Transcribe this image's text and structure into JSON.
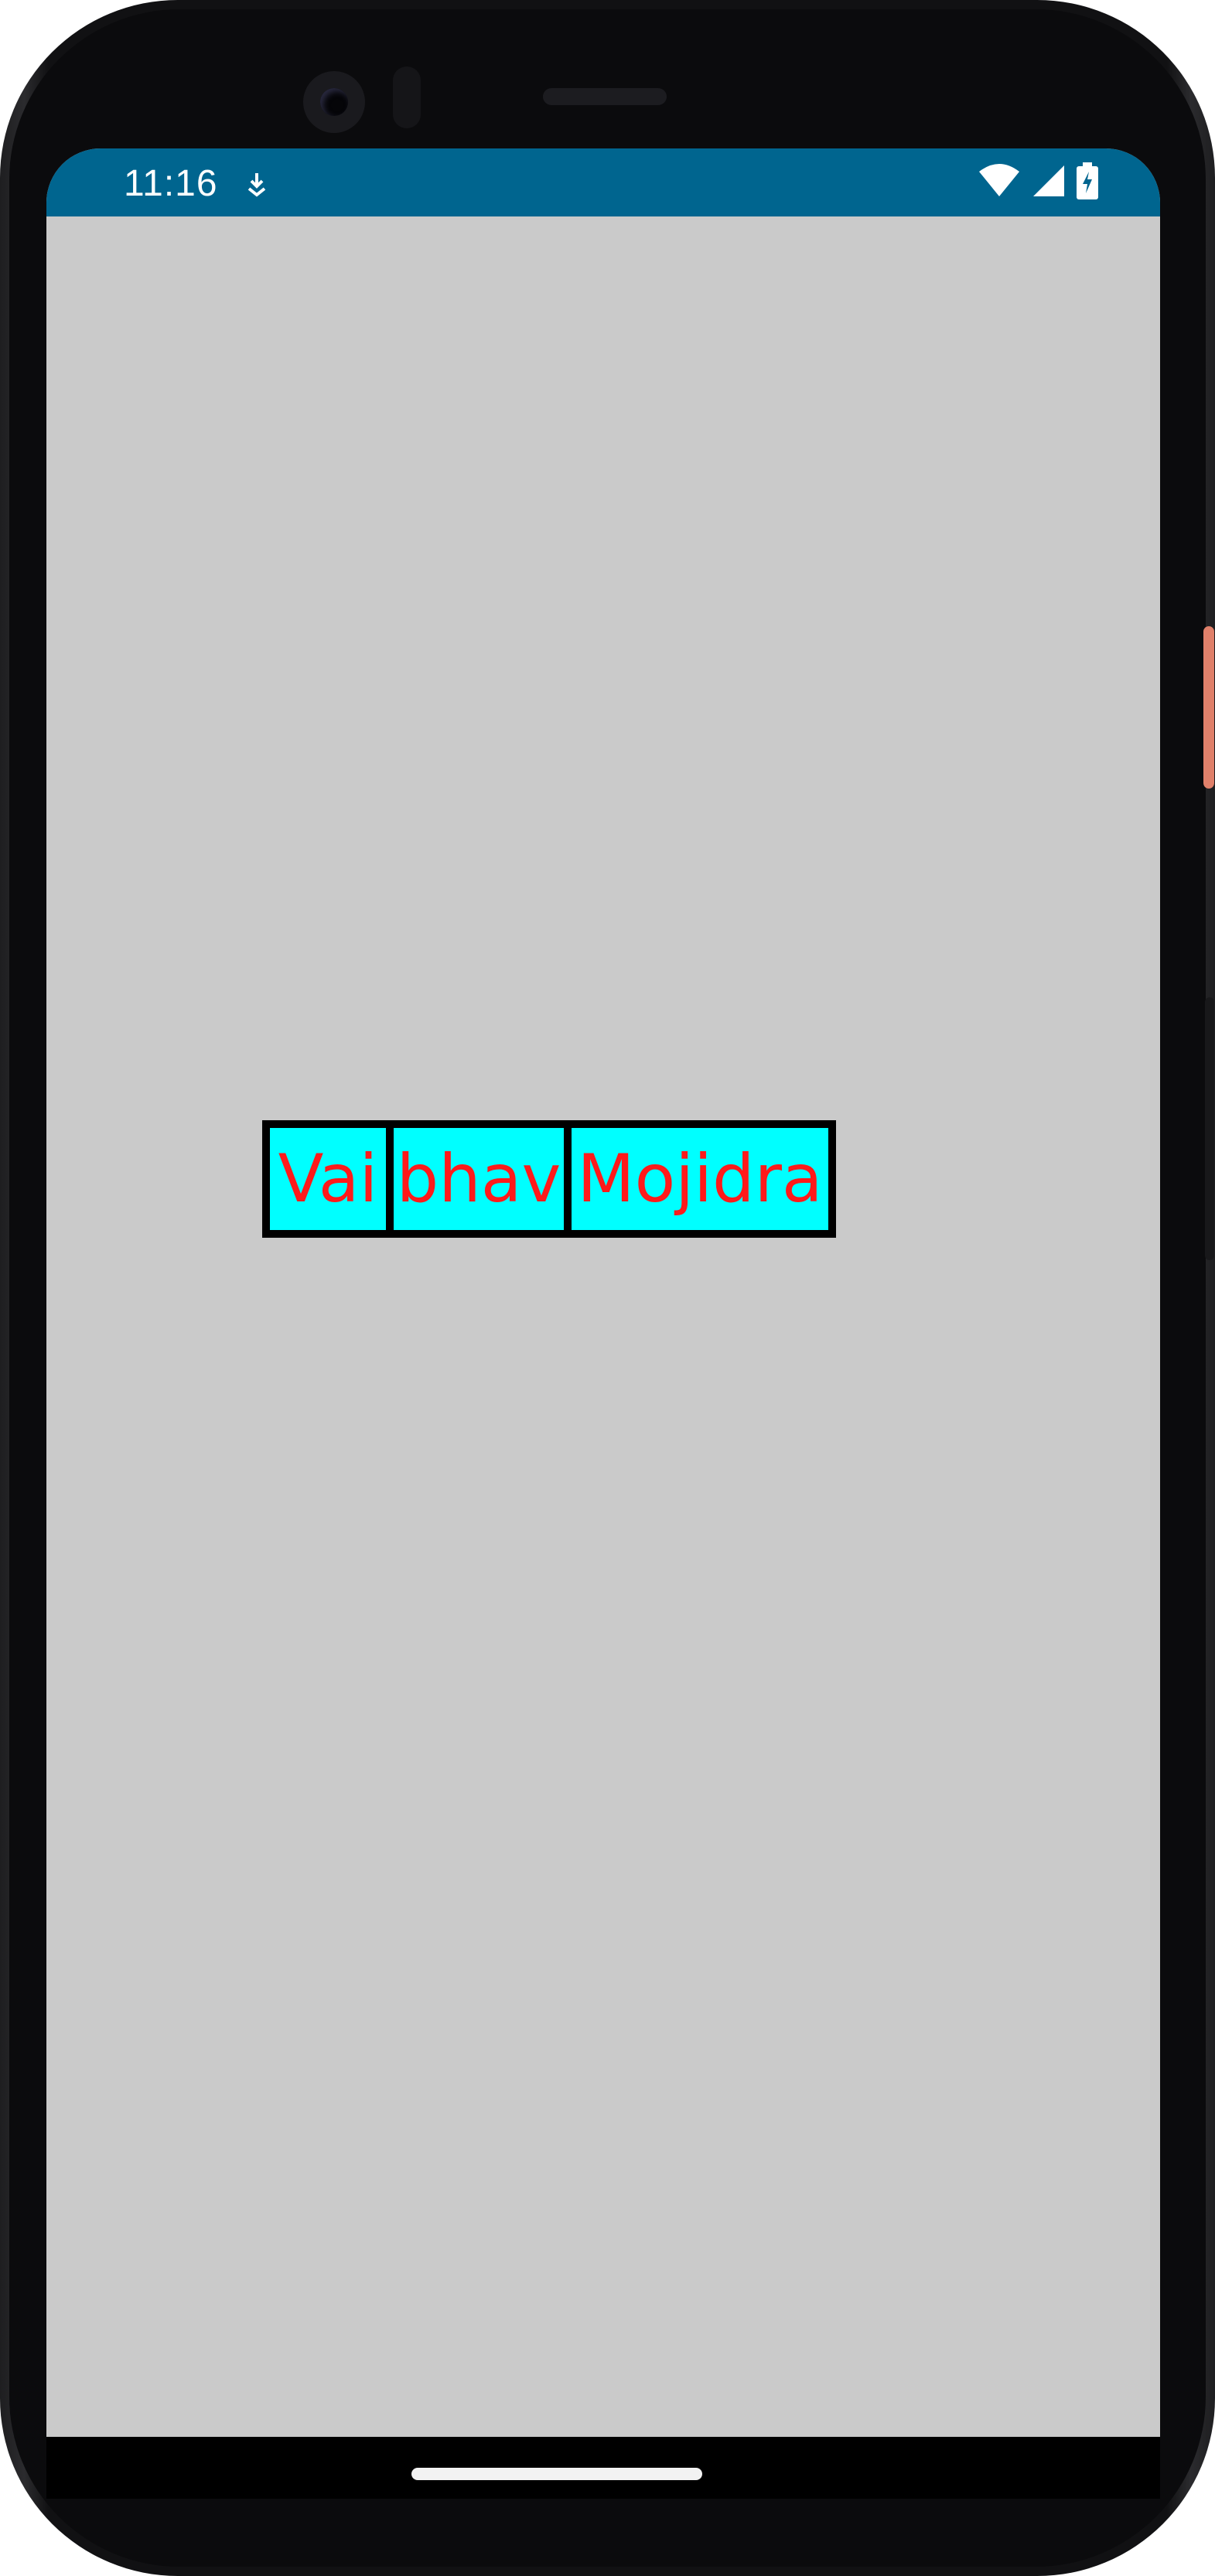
{
  "status_bar": {
    "time": "11:16",
    "bg_color": "#00658f",
    "icons": [
      "download-icon",
      "wifi-icon",
      "signal-icon",
      "battery-charging-icon"
    ]
  },
  "screen": {
    "bg_color": "#cacaca",
    "name_parts": [
      "Vai",
      "bhav",
      "Mojidra"
    ],
    "box_color": "#00ffff",
    "text_color": "#ff1a1a",
    "border_color": "#000000"
  }
}
